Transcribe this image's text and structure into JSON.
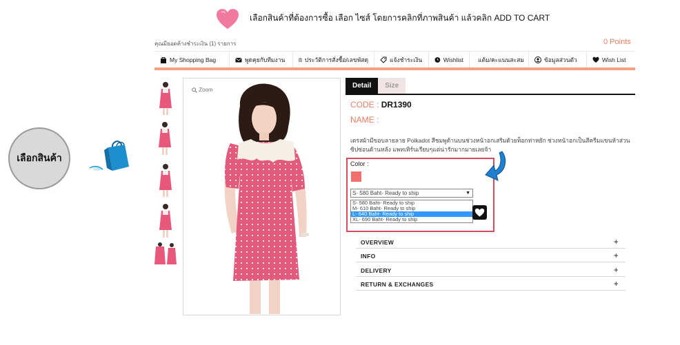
{
  "instruction": "เลือกสินค้าที่ต้องการซื้อ เลือก ไซส์ โดยการคลิกที่ภาพสินค้า แล้วคลิก ADD TO CART",
  "left_button": "เลือกสินค้า",
  "status": "คุณมียอดค้างชำระเงิน (1) รายการ",
  "points": "0 Points",
  "nav": [
    {
      "label": "My Shopping Bag",
      "icon": "shopping-bag-icon"
    },
    {
      "label": "พูดคุยกับทีมงาน",
      "icon": "mail-icon"
    },
    {
      "label": "ประวัติการสั่งซื้อ/เลขพัสดุ",
      "icon": "clipboard-icon"
    },
    {
      "label": "แจ้งชำระเงิน",
      "icon": "tag-icon"
    },
    {
      "label": "Wishlist",
      "icon": "clock-icon"
    },
    {
      "label": "แต้ม/คะแนนสะสม",
      "icon": "trophy-icon"
    },
    {
      "label": "ข้อมูลส่วนตัว",
      "icon": "user-icon"
    },
    {
      "label": "Wish List",
      "icon": "heart-icon"
    }
  ],
  "zoom_label": "Zoom",
  "tabs": [
    "Detail",
    "Size"
  ],
  "code_label": "CODE :",
  "code_value": "DR1390",
  "name_label": "NAME :",
  "description": "เดรสผ้ามีขอบลายลาย Polkadot สีชมพูด้านบนช่วงหน้าอกเสริมด้วยท็อกท่าหยัก ช่วงหน้าอกเป็นสีครีมแขนห้าส่วน ซิปซ่อนด้านหลัง แพทเทิร์นเรียบๆแต่น่ารักมากมายเลยจ้า",
  "color_label": "Color :",
  "swatch_color": "#f0706e",
  "select_value": "S- 580 Baht- Ready to ship",
  "options": [
    "S- 580 Baht- Ready to ship",
    "M- 610 Baht- Ready to ship",
    "L- 640 Baht- Ready to ship",
    "XL- 690 Baht- Ready to ship"
  ],
  "selected_option_index": 2,
  "accordion": [
    "OVERVIEW",
    "INFO",
    "DELIVERY",
    "RETURN & EXCHANGES"
  ],
  "accent": "#f3a083",
  "highlight": "#d64a5c"
}
